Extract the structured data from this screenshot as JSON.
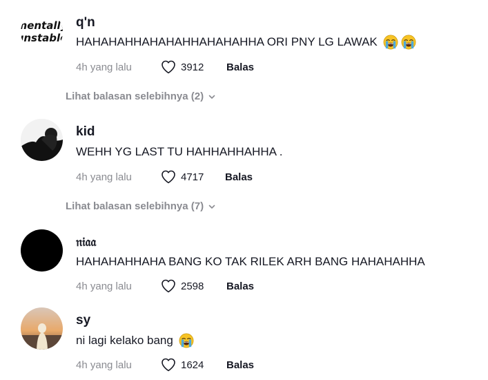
{
  "comments": [
    {
      "username": "q'n",
      "avatar_text_1": "mentally",
      "avatar_text_2": "unstable",
      "text": "HAHAHAHHAHAHAHHAHAHAHHA ORI PNY LG LAWAK",
      "emojis": [
        "loudly-crying-face",
        "loudly-crying-face"
      ],
      "time": "4h yang lalu",
      "likes": "3912",
      "reply_label": "Balas",
      "view_more": "Lihat balasan selebihnya (2)"
    },
    {
      "username": "kid",
      "text": "WEHH YG LAST TU HAHHAHHAHHA .",
      "time": "4h yang lalu",
      "likes": "4717",
      "reply_label": "Balas",
      "view_more": "Lihat balasan selebihnya (7)"
    },
    {
      "username": "𝔫𝔦𝔞𝔞",
      "text": "HAHAHAHHAHA BANG KO TAK RILEK ARH BANG HAHAHAHHA",
      "time": "4h yang lalu",
      "likes": "2598",
      "reply_label": "Balas"
    },
    {
      "username": "sy",
      "text": "ni lagi kelako bang",
      "emojis": [
        "loudly-crying-face"
      ],
      "time": "4h yang lalu",
      "likes": "1624",
      "reply_label": "Balas"
    }
  ],
  "colors": {
    "text_primary": "#161823",
    "text_secondary": "#8a8b91",
    "emoji_face": "#f7c325"
  }
}
